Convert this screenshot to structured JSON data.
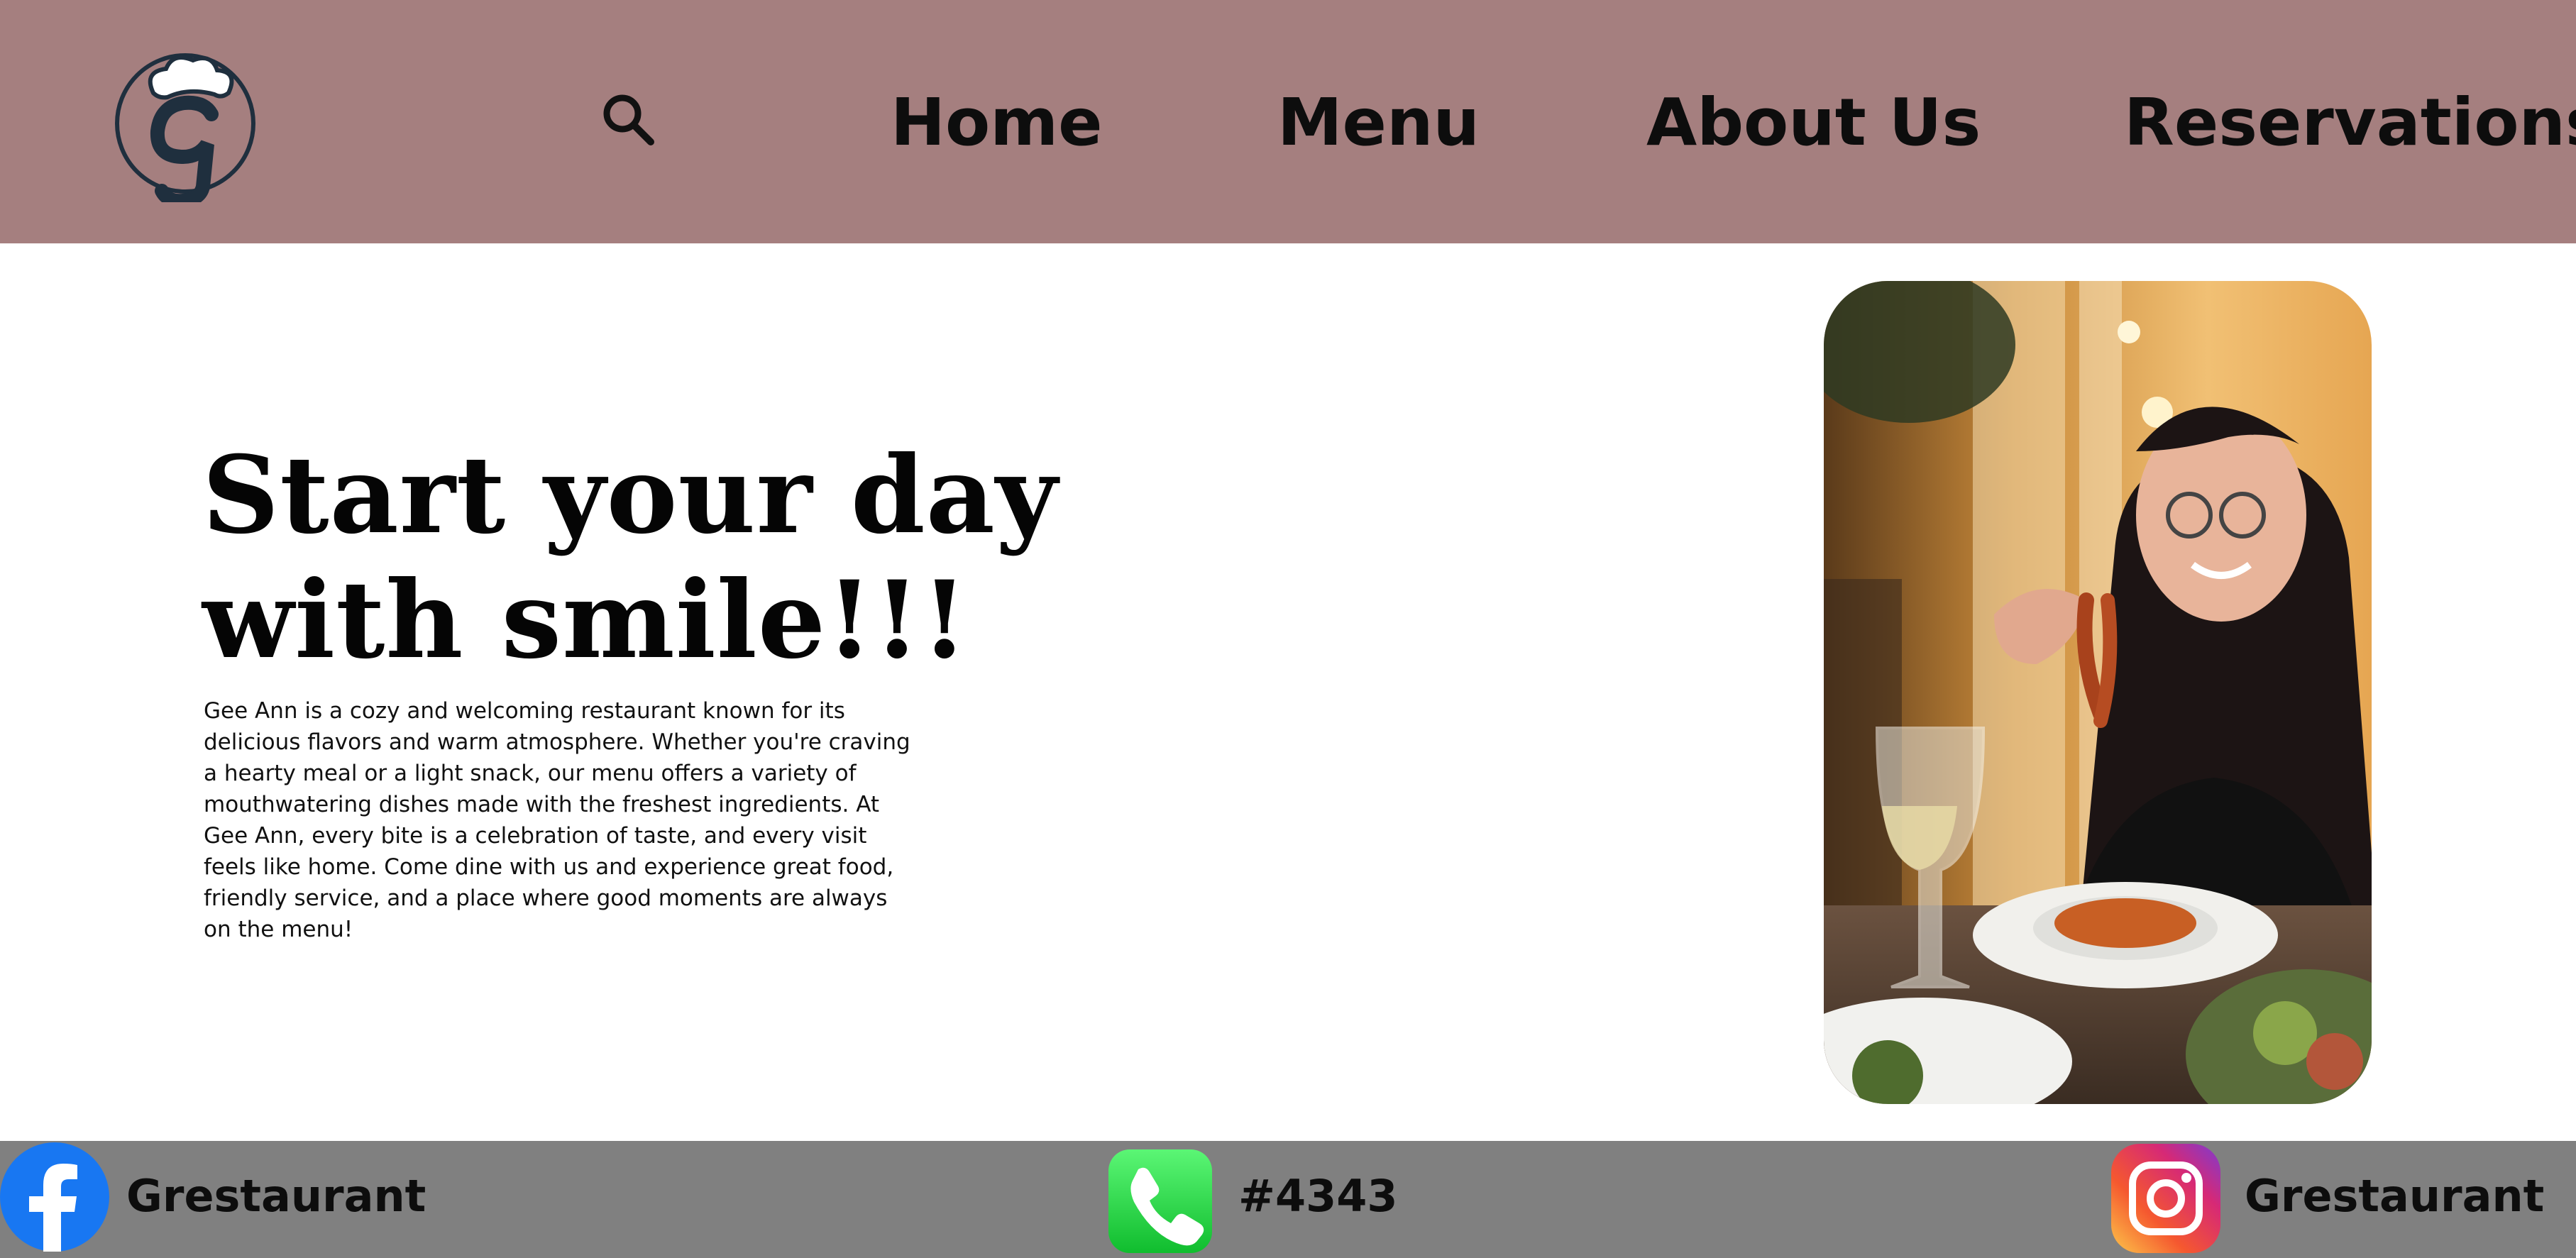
{
  "header": {
    "logo_icon": "chef-hat-g-logo-icon",
    "search_icon": "search-icon",
    "nav": [
      {
        "label": "Home"
      },
      {
        "label": "Menu"
      },
      {
        "label": "About Us"
      },
      {
        "label": "Reservations"
      }
    ],
    "background_color": "#a57f7f"
  },
  "hero": {
    "title_line1": "Start your day",
    "title_line2": "with smile!!!",
    "description": "Gee Ann is a cozy and welcoming restaurant known for its delicious flavors and warm atmosphere. Whether you're craving a hearty meal or a light snack, our menu offers a variety of mouthwatering dishes made with the freshest ingredients. At Gee Ann, every bite is a celebration of taste, and every visit feels like home. Come dine with us and experience great food, friendly service, and a place where good moments are always on the menu!",
    "photo": "woman-eating-pasta-photo"
  },
  "footer": {
    "background_color": "#808080",
    "facebook": {
      "icon": "facebook-icon",
      "label": "Grestaurant"
    },
    "phone": {
      "icon": "phone-icon",
      "label": "#4343"
    },
    "instagram": {
      "icon": "instagram-icon",
      "label": "Grestaurant"
    }
  }
}
